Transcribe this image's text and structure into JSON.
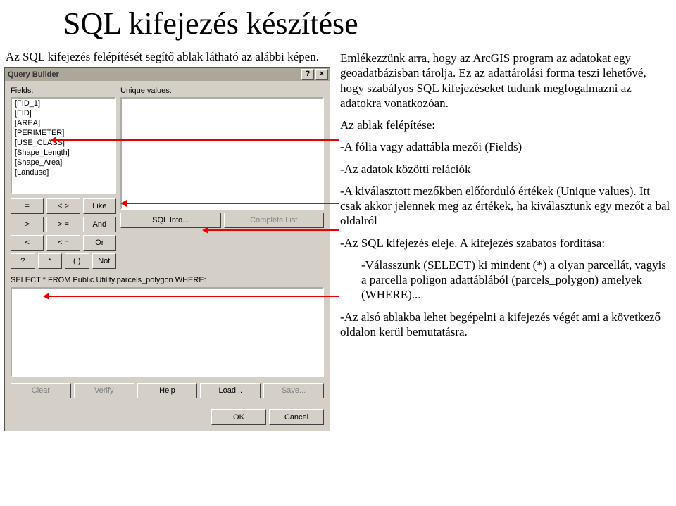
{
  "page_title": "SQL kifejezés készítése",
  "intro": "Az SQL kifejezés felépítését segítő ablak látható az alábbi képen.",
  "right": {
    "p1": "Emlékezzünk arra, hogy az ArcGIS program az adatokat egy geoadatbázisban tárolja. Ez az adattárolási forma teszi lehetővé, hogy szabályos SQL kifejezéseket tudunk megfogalmazni az adatokra vonatkozóan.",
    "p2": "Az ablak felépítése:",
    "p3": "-A fólia vagy adattábla mezői (Fields)",
    "p4": "-Az adatok közötti relációk",
    "p5": "-A kiválasztott mezőkben előforduló értékek (Unique values). Itt csak akkor jelennek meg az értékek, ha kiválasztunk egy mezőt a bal oldalról",
    "p6": "-Az SQL kifejezés eleje. A kifejezés szabatos fordítása:",
    "p7": "-Válasszunk (SELECT) ki mindent (*) a olyan parcellát, vagyis a parcella poligon adattáblából (parcels_polygon) amelyek (WHERE)...",
    "p8": "-Az alsó ablakba lehet begépelni a kifejezés végét ami a következő oldalon kerül bemutatásra."
  },
  "qb": {
    "title": "Query Builder",
    "labels": {
      "fields": "Fields:",
      "unique": "Unique values:"
    },
    "fields": [
      "[FID_1]",
      "[FID]",
      "[AREA]",
      "[PERIMETER]",
      "[USE_CLASS]",
      "[Shape_Length]",
      "[Shape_Area]",
      "[Landuse]"
    ],
    "ops": [
      [
        "=",
        "< >",
        "Like"
      ],
      [
        ">",
        "> =",
        "And"
      ],
      [
        "<",
        "< =",
        "Or"
      ],
      [
        "?",
        "*",
        "( )",
        "Not"
      ]
    ],
    "uv_buttons": {
      "sql_info": "SQL Info...",
      "complete": "Complete List"
    },
    "select_line": "SELECT * FROM Public Utility.parcels_polygon WHERE:",
    "bottom": [
      "Clear",
      "Verify",
      "Help",
      "Load...",
      "Save..."
    ],
    "footer": [
      "OK",
      "Cancel"
    ]
  }
}
